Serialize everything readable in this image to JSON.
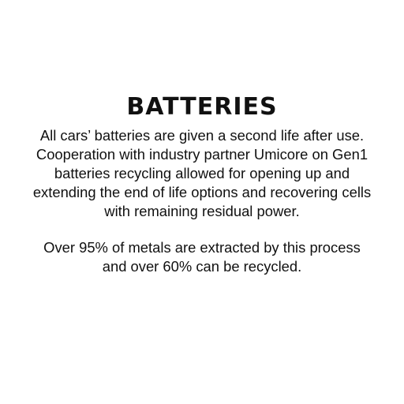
{
  "title": "BATTERIES",
  "paragraphs": {
    "p1": "All cars’ batteries are given a second life after use. Cooperation with industry partner Umicore on Gen1 batteries recycling allowed for opening up and extending the end of life options and recovering cells with remaining residual power.",
    "p2": "Over 95% of metals are extracted by this process and over 60% can be recycled."
  },
  "colors": {
    "background": "#ffffff",
    "text": "#111111"
  }
}
